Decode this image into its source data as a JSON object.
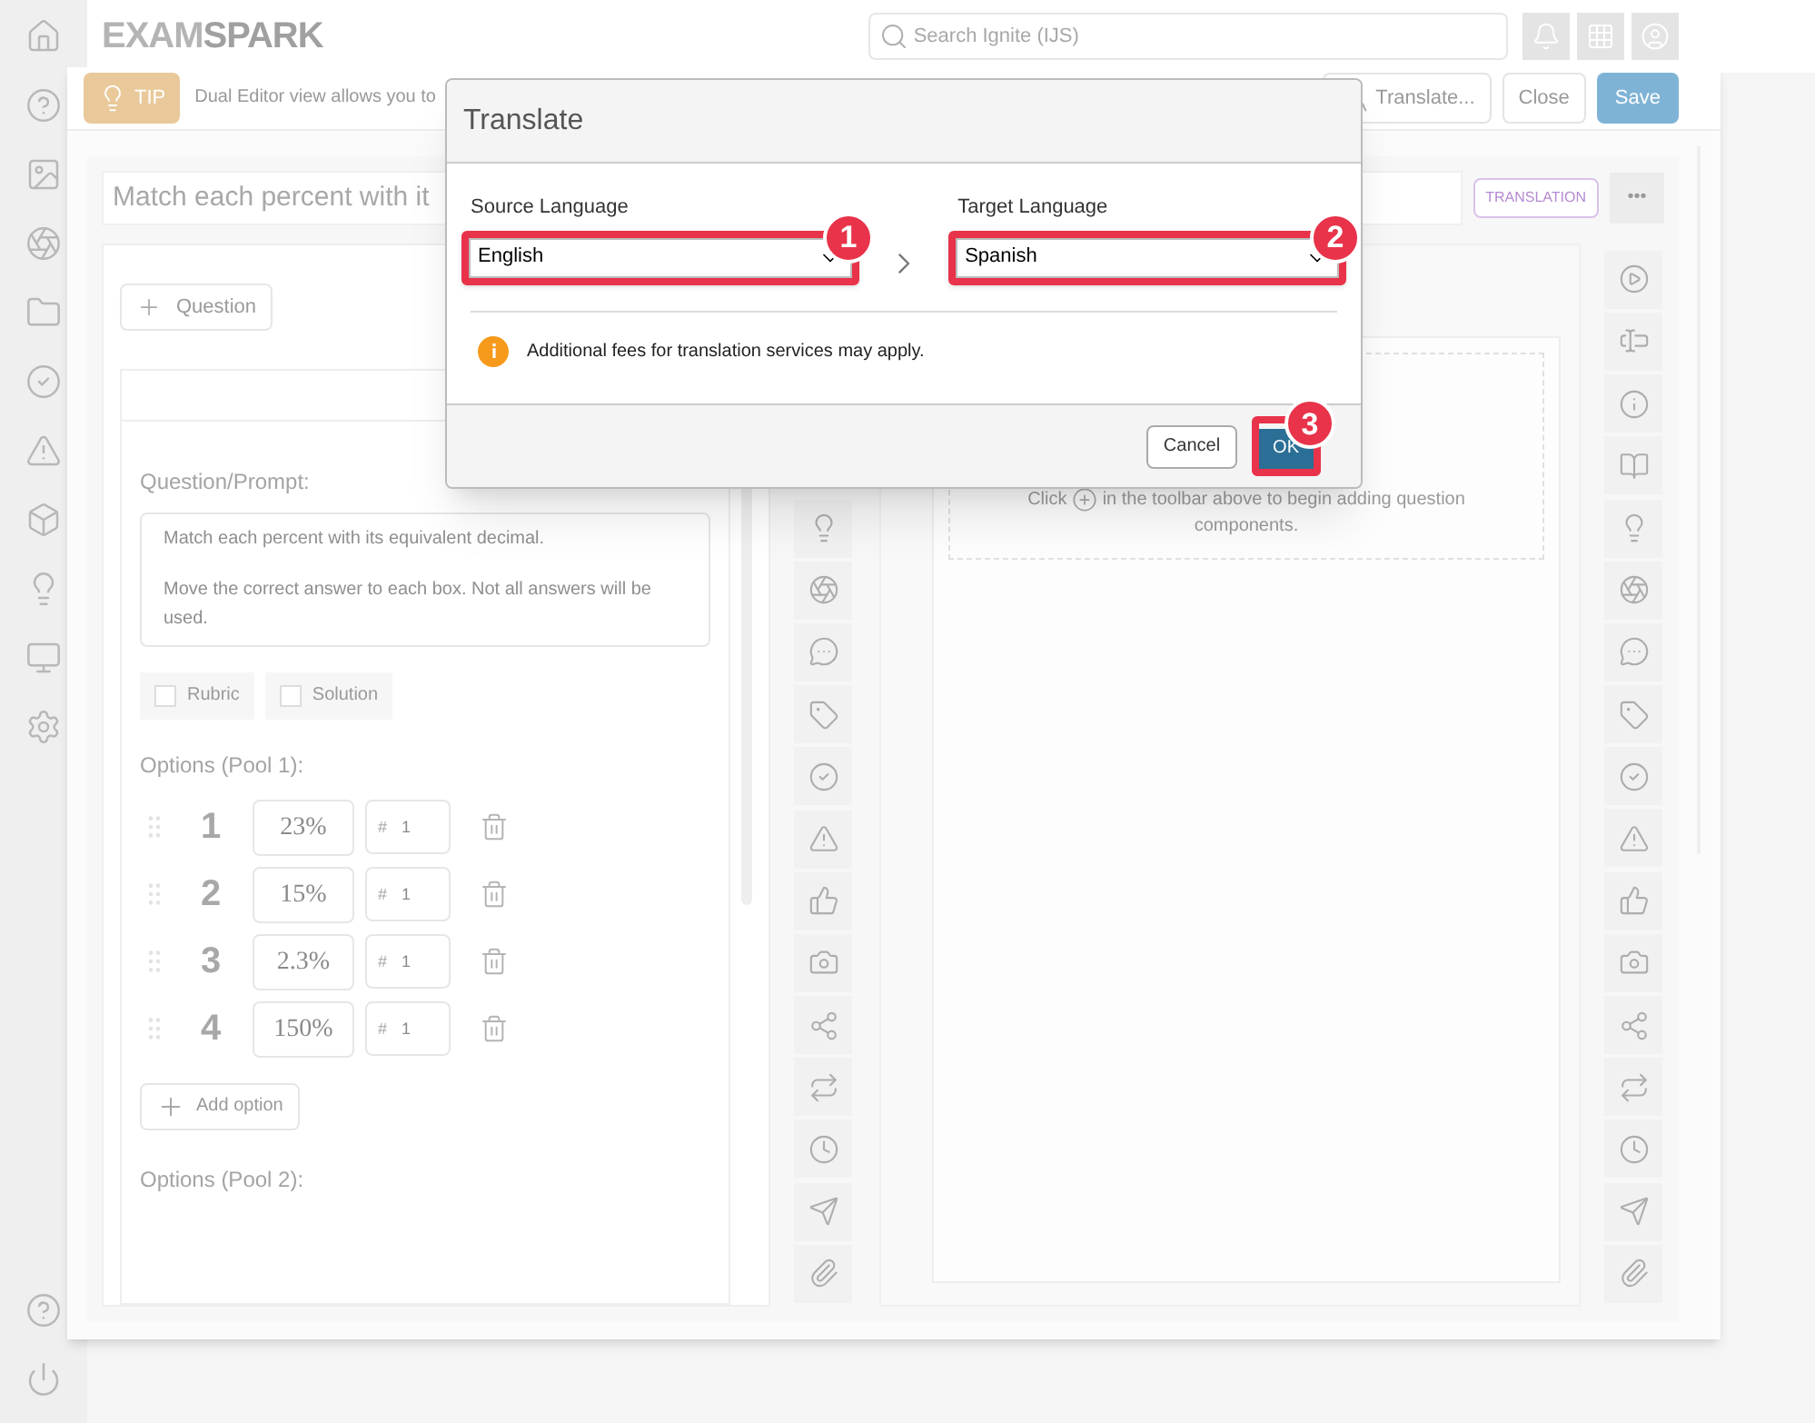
{
  "app_bar": {
    "logo": {
      "first": "EXAM",
      "second": "SPARK"
    },
    "search": {
      "placeholder": "Search Ignite (IJS)"
    }
  },
  "editor": {
    "tip": {
      "badge": "TIP",
      "text": "Dual Editor view allows you to"
    },
    "buttons": [
      {
        "label": "Translate...",
        "kind": "icon"
      },
      {
        "label": "Close",
        "kind": "plain"
      },
      {
        "label": "Save",
        "kind": "primary"
      }
    ],
    "title": "Match each percent with it",
    "translation_badge": "TRANSLATION",
    "more": "•••",
    "left_pane": {
      "add_question": "Question",
      "prompt_label": "Question/Prompt:",
      "prompt_paragraphs": [
        "Match each percent with its equivalent decimal.",
        "Move the correct answer to each box. Not all answers will be used."
      ],
      "checkboxes": [
        {
          "label": "Rubric",
          "checked": false
        },
        {
          "label": "Solution",
          "checked": false
        }
      ],
      "pool1_label": "Options (Pool 1):",
      "options": [
        {
          "number": "1",
          "value": "23%",
          "prefix": "#",
          "count": "1"
        },
        {
          "number": "2",
          "value": "15%",
          "prefix": "#",
          "count": "1"
        },
        {
          "number": "3",
          "value": "2.3%",
          "prefix": "#",
          "count": "1"
        },
        {
          "number": "4",
          "value": "150%",
          "prefix": "#",
          "count": "1"
        }
      ],
      "add_option": "Add option",
      "pool2_label": "Options (Pool 2):"
    },
    "right_pane": {
      "hint_before": "Click",
      "hint_after": "in the toolbar above to begin adding question components."
    }
  },
  "dialog": {
    "title": "Translate",
    "source": {
      "label": "Source Language",
      "value": "English",
      "step": "1"
    },
    "target": {
      "label": "Target Language",
      "value": "Spanish",
      "step": "2"
    },
    "note": "Additional fees for translation services may apply.",
    "cancel": "Cancel",
    "ok": {
      "label": "OK",
      "step": "3"
    }
  }
}
